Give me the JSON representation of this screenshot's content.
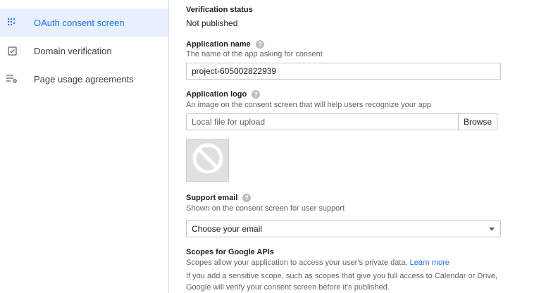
{
  "sidebar": {
    "items": [
      {
        "label": "OAuth consent screen",
        "icon": "oauth-dots-icon",
        "active": true
      },
      {
        "label": "Domain verification",
        "icon": "checkbox-icon",
        "active": false
      },
      {
        "label": "Page usage agreements",
        "icon": "list-settings-icon",
        "active": false
      }
    ]
  },
  "verification": {
    "heading": "Verification status",
    "value": "Not published"
  },
  "app_name": {
    "heading": "Application name",
    "description": "The name of the app asking for consent",
    "value": "project-605002822939"
  },
  "app_logo": {
    "heading": "Application logo",
    "description": "An image on the consent screen that will help users recognize your app",
    "placeholder": "Local file for upload",
    "browse_label": "Browse"
  },
  "support_email": {
    "heading": "Support email",
    "description": "Shown on the consent screen for user support",
    "selected": "Choose your email"
  },
  "scopes": {
    "heading": "Scopes for Google APIs",
    "description": "Scopes allow your application to access your user's private data.",
    "learn_more": "Learn more",
    "note_line1": "If you add a sensitive scope, such as scopes that give you full access to Calendar or Drive,",
    "note_line2": "Google will verify your consent screen before it's published."
  },
  "colors": {
    "accent": "#1a73e8",
    "active_bg": "#e8f0fe",
    "help_icon": "#bdbdbd"
  }
}
